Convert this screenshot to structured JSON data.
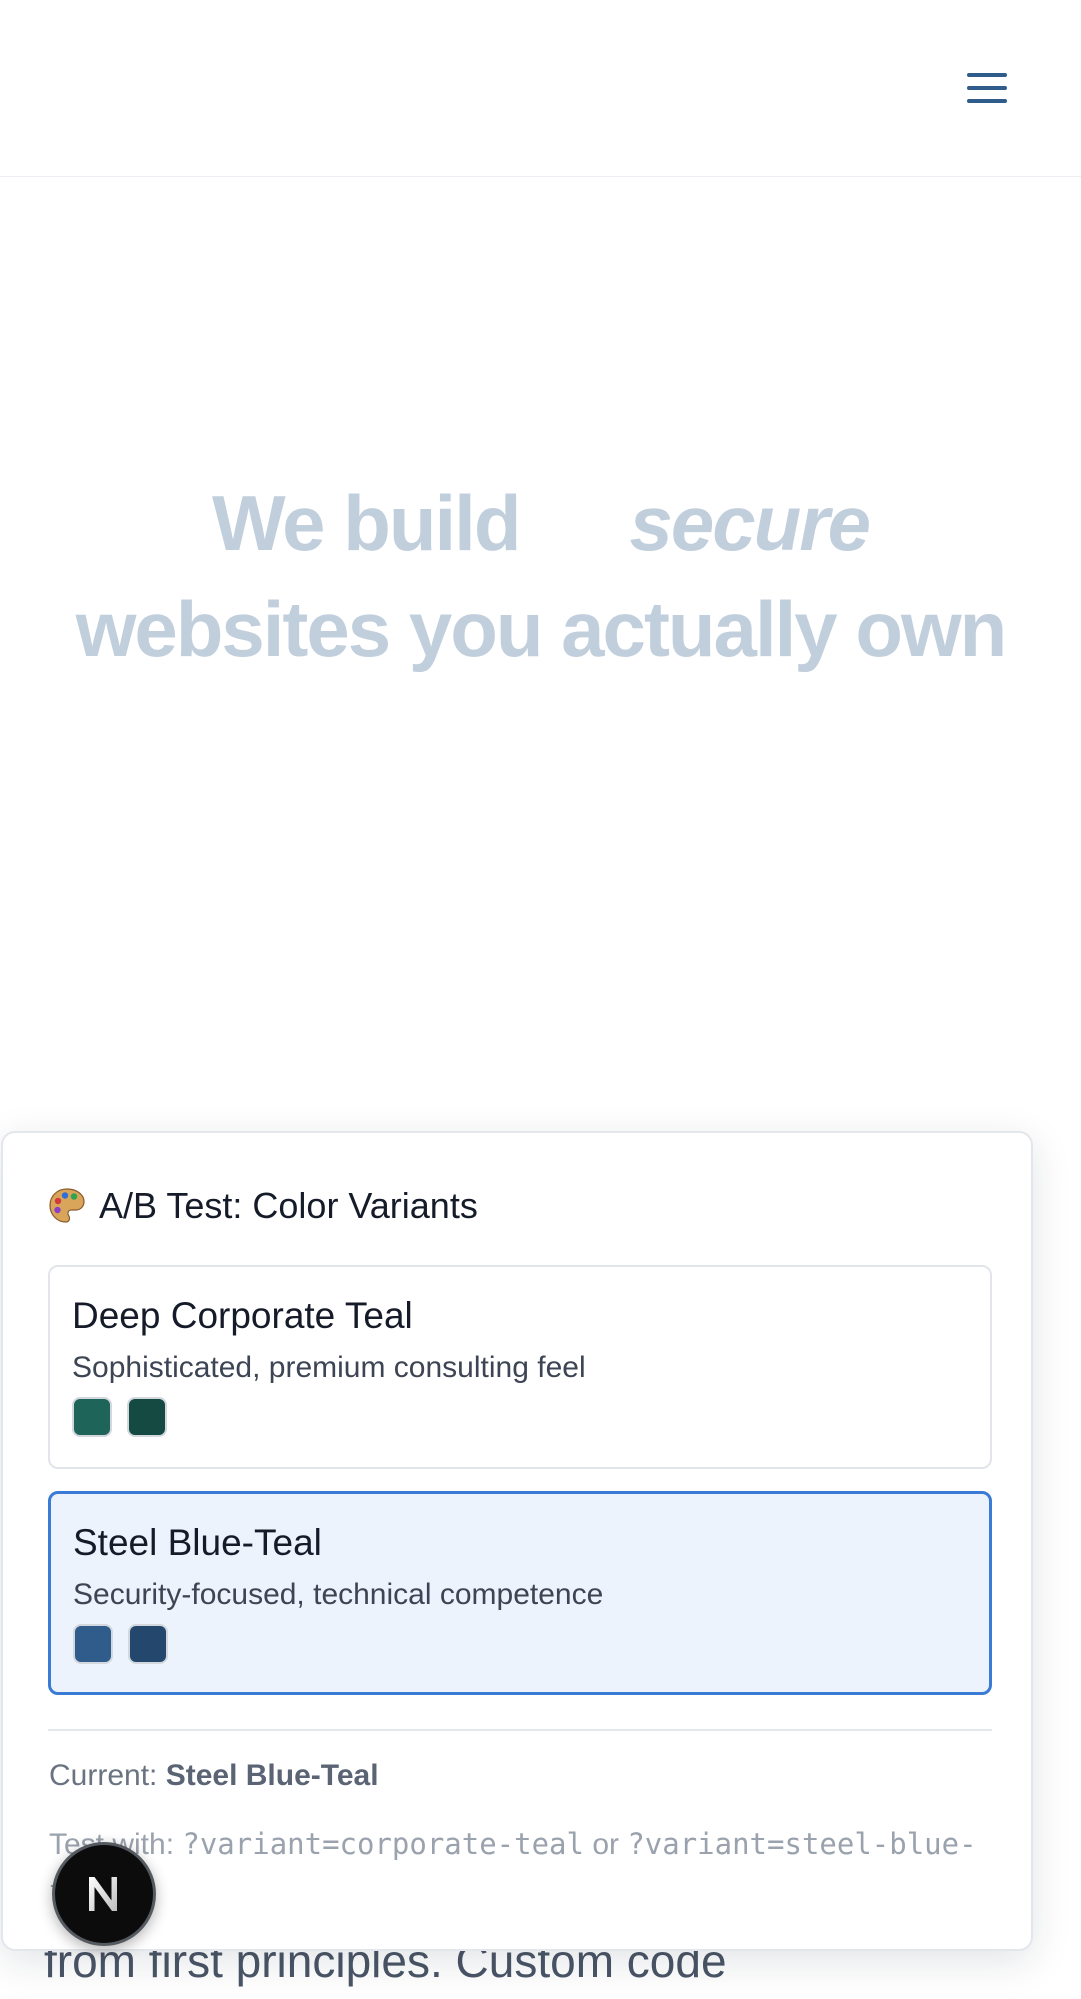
{
  "header": {
    "menu_icon": "hamburger-menu-icon",
    "accent_color": "#2f5c8a"
  },
  "hero": {
    "line1_prefix": "We build",
    "line1_emphasis": "secure",
    "line2": "websites you actually own",
    "text_color": "#c1cfdd"
  },
  "background_text": "from first principles. Custom code",
  "ab_panel": {
    "icon": "palette-icon",
    "title": "A/B Test: Color Variants",
    "variants": [
      {
        "name": "Deep Corporate Teal",
        "description": "Sophisticated, premium consulting feel",
        "swatches": [
          "#1e6459",
          "#154a42"
        ],
        "selected": false
      },
      {
        "name": "Steel Blue-Teal",
        "description": "Security-focused, technical competence",
        "swatches": [
          "#2f5c8a",
          "#23476d"
        ],
        "selected": true
      }
    ],
    "current_label": "Current:",
    "current_value": "Steel Blue-Teal",
    "test_label": "Test with:",
    "test_param_1": "?variant=corporate-teal",
    "test_or": "or",
    "test_param_2": "?variant=steel-blue-teal",
    "selected_border_color": "#3a7bd5",
    "selected_background": "#edf3fd"
  },
  "dev_badge": {
    "letter": "N"
  }
}
